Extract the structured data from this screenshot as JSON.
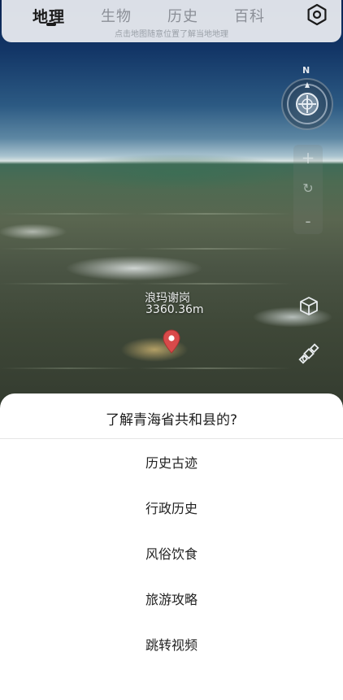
{
  "tabs": [
    {
      "label": "地理",
      "active": true
    },
    {
      "label": "生物",
      "active": false
    },
    {
      "label": "历史",
      "active": false
    },
    {
      "label": "百科",
      "active": false
    }
  ],
  "hint": "点击地图随意位置了解当地地理",
  "compass": {
    "north_label": "N"
  },
  "zoom": {
    "in": "+",
    "reset": "↻",
    "out": "-"
  },
  "place": {
    "name": "浪玛谢岗",
    "elevation": "3360.36m"
  },
  "icons": {
    "settings": "hexagon-settings-icon",
    "compass": "compass-icon",
    "view_3d": "cube-icon",
    "satellite": "satellite-icon",
    "pin": "map-pin-icon"
  },
  "colors": {
    "accent": "#1b1b1b",
    "pin": "#d94a4a"
  },
  "sheet": {
    "title": "了解青海省共和县的?",
    "options": [
      "历史古迹",
      "行政历史",
      "风俗饮食",
      "旅游攻略",
      "跳转视频"
    ]
  }
}
